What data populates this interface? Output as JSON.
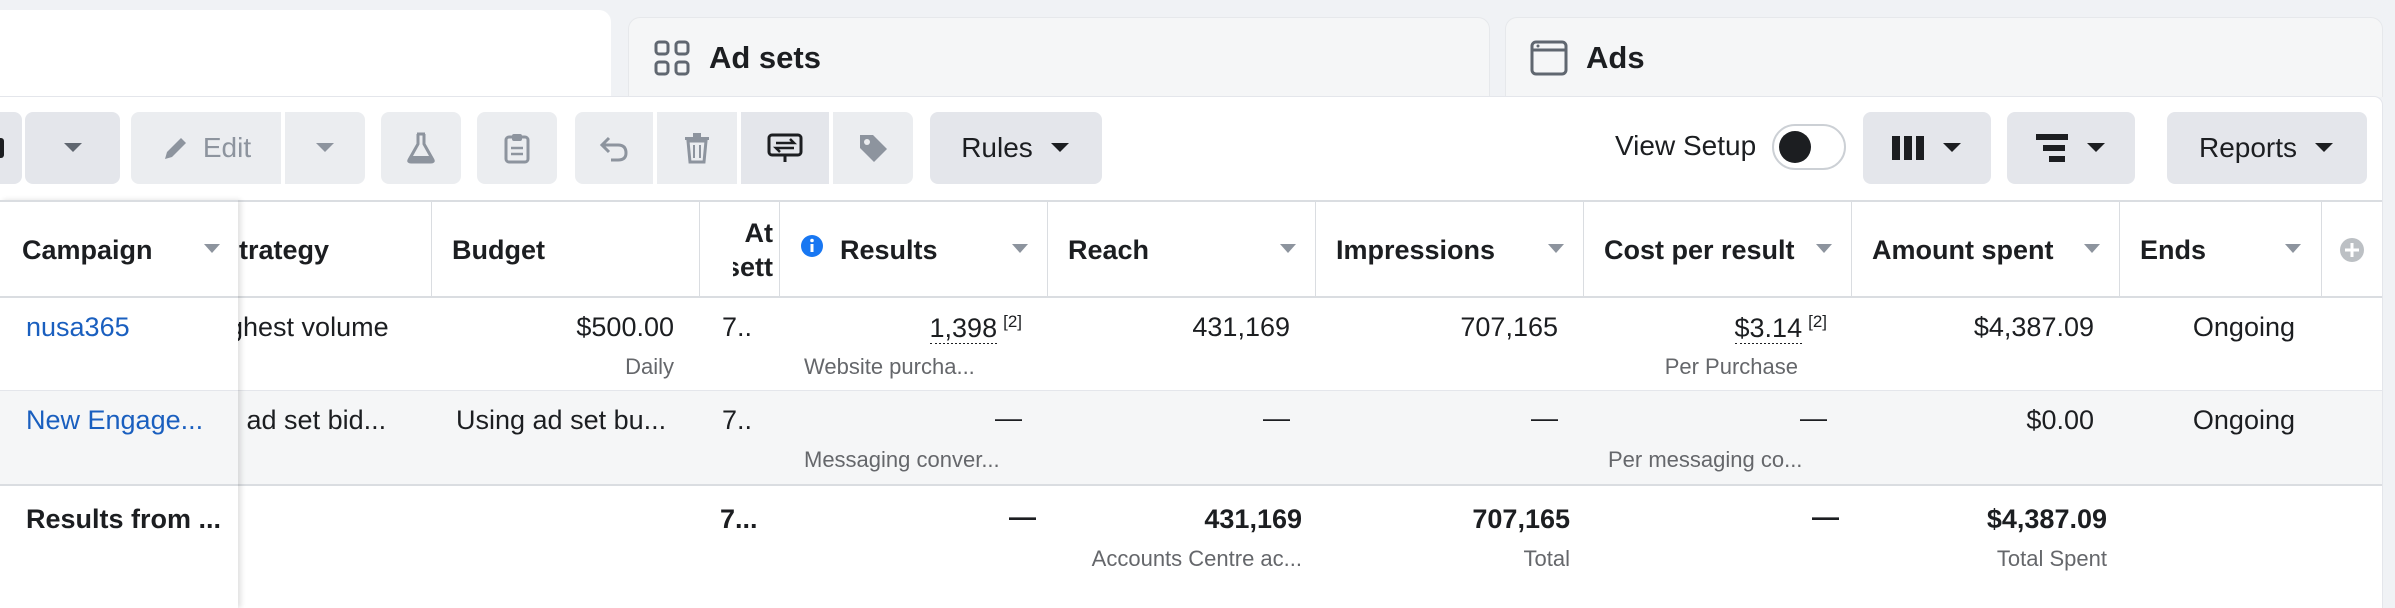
{
  "tabs": {
    "ad_sets": "Ad sets",
    "ads": "Ads"
  },
  "toolbar": {
    "edit_label": "Edit",
    "rules_label": "Rules",
    "view_setup_label": "View Setup",
    "view_setup_on": false,
    "reports_label": "Reports"
  },
  "columns": {
    "campaign": "Campaign",
    "bid_strategy": "strategy",
    "budget": "Budget",
    "attribution_line1": "At",
    "attribution_line2": "sett",
    "results": "Results",
    "reach": "Reach",
    "impressions": "Impressions",
    "cost_per_result": "Cost per result",
    "amount_spent": "Amount spent",
    "ends": "Ends"
  },
  "rows": [
    {
      "campaign": "nusa365",
      "bid_strategy": "ghest volume",
      "budget": "$500.00",
      "budget_sub": "Daily",
      "attribution": "7..",
      "results": "1,398",
      "results_fn": "[2]",
      "results_sub": "Website purcha...",
      "reach": "431,169",
      "impressions": "707,165",
      "cost_per_result": "$3.14",
      "cost_fn": "[2]",
      "cost_sub": "Per Purchase",
      "amount_spent": "$4,387.09",
      "ends": "Ongoing"
    },
    {
      "campaign": "New Engage...",
      "bid_strategy": "g ad set bid...",
      "budget": "Using ad set bu...",
      "attribution": "7..",
      "results": "—",
      "results_sub": "Messaging conver...",
      "reach": "—",
      "impressions": "—",
      "cost_per_result": "—",
      "cost_sub": "Per messaging co...",
      "amount_spent": "$0.00",
      "ends": "Ongoing"
    }
  ],
  "totals": {
    "campaign": "Results from ...",
    "attribution": "7...",
    "results": "—",
    "reach": "431,169",
    "reach_sub": "Accounts Centre ac...",
    "impressions": "707,165",
    "impressions_sub": "Total",
    "cost_per_result": "—",
    "amount_spent": "$4,387.09",
    "amount_spent_sub": "Total Spent"
  },
  "colors": {
    "link": "#1a5fbf",
    "info_icon": "#1877f2",
    "text": "#1c1e21",
    "muted": "#65676b"
  }
}
